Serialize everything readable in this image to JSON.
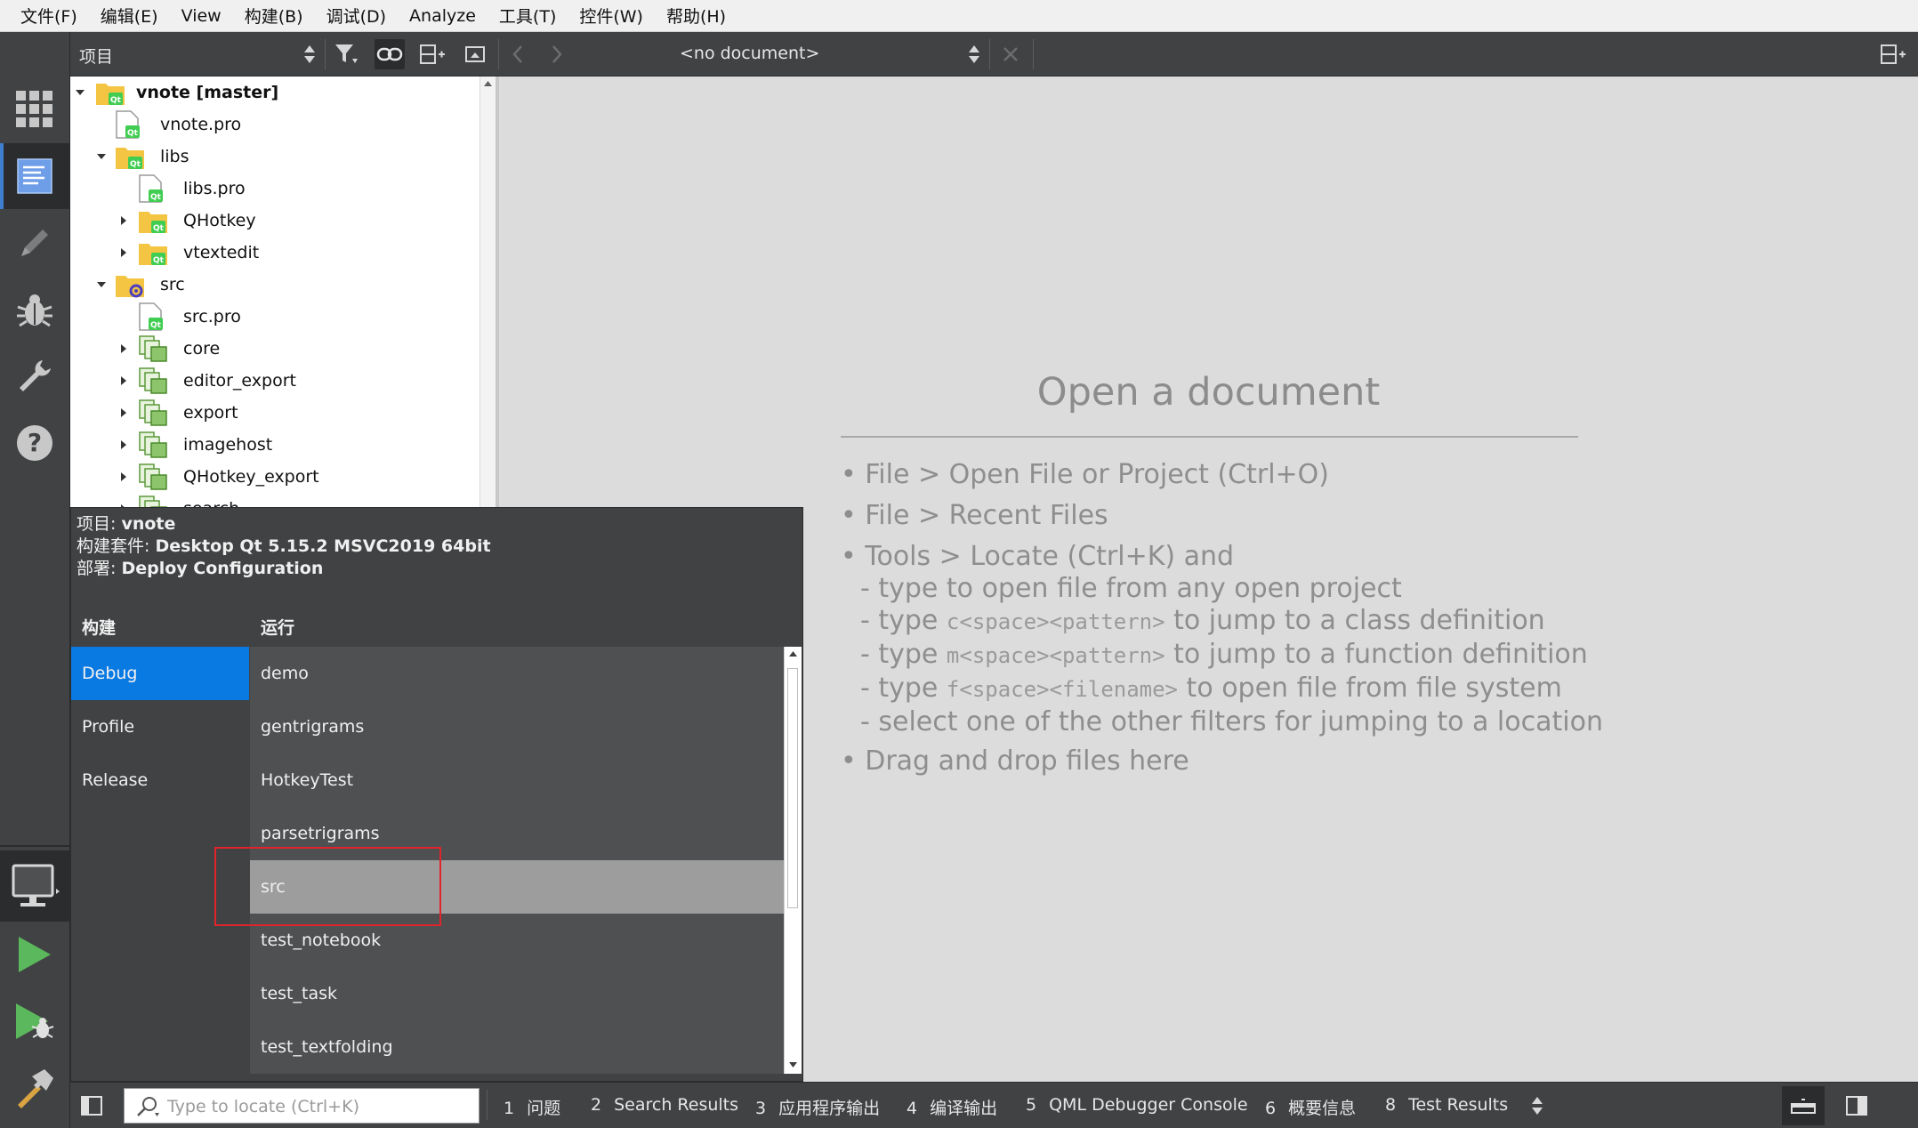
{
  "menu": [
    "文件(F)",
    "编辑(E)",
    "View",
    "构建(B)",
    "调试(D)",
    "Analyze",
    "工具(T)",
    "控件(W)",
    "帮助(H)"
  ],
  "toolbar": {
    "view_selector": "项目",
    "document_selector": "<no document>"
  },
  "tree": {
    "root": "vnote [master]",
    "items": [
      {
        "label": "vnote.pro"
      },
      {
        "label": "libs"
      },
      {
        "label": "libs.pro"
      },
      {
        "label": "QHotkey"
      },
      {
        "label": "vtextedit"
      },
      {
        "label": "src"
      },
      {
        "label": "src.pro"
      },
      {
        "label": "core"
      },
      {
        "label": "editor_export"
      },
      {
        "label": "export"
      },
      {
        "label": "imagehost"
      },
      {
        "label": "QHotkey_export"
      },
      {
        "label": "search"
      }
    ]
  },
  "editor": {
    "title": "Open a document",
    "tips": [
      "• File > Open File or Project (Ctrl+O)",
      "• File > Recent Files",
      "• Tools > Locate (Ctrl+K) and",
      "- type to open file from any open project"
    ],
    "tip5": {
      "a": "- type ",
      "code": "c<space><pattern>",
      "b": " to jump to a class definition"
    },
    "tip6": {
      "a": "- type ",
      "code": "m<space><pattern>",
      "b": " to jump to a function definition"
    },
    "tip7": {
      "a": "- type ",
      "code": "f<space><filename>",
      "b": " to open file from file system"
    },
    "tip8": "- select one of the other filters for jumping to a location",
    "tip9": "• Drag and drop files here"
  },
  "kit": {
    "project_label": "项目: ",
    "project_value": "vnote",
    "kit_label": "构建套件: ",
    "kit_value": "Desktop Qt 5.15.2 MSVC2019 64bit",
    "deploy_label": "部署: ",
    "deploy_value": "Deploy Configuration",
    "build_header": "构建",
    "run_header": "运行",
    "build_configs": [
      "Debug",
      "Profile",
      "Release"
    ],
    "build_selected": "Debug",
    "run_configs": [
      "demo",
      "gentrigrams",
      "HotkeyTest",
      "parsetrigrams",
      "src",
      "test_notebook",
      "test_task",
      "test_textfolding"
    ],
    "run_selected": "src"
  },
  "statusbar": {
    "locator_placeholder": "Type to locate (Ctrl+K)",
    "panes": [
      {
        "num": "1",
        "label": "问题"
      },
      {
        "num": "2",
        "label": "Search Results"
      },
      {
        "num": "3",
        "label": "应用程序输出"
      },
      {
        "num": "4",
        "label": "编译输出"
      },
      {
        "num": "5",
        "label": "QML Debugger Console"
      },
      {
        "num": "6",
        "label": "概要信息"
      },
      {
        "num": "8",
        "label": "Test Results"
      }
    ]
  },
  "colors": {
    "accent": "#0a7ae3",
    "highlight_box": "#e0242b",
    "dark_panel": "#404244",
    "qt_green": "#41cd52"
  },
  "icons": [
    "welcome-grid-icon",
    "edit-icon",
    "design-pencil-icon",
    "debug-bug-icon",
    "projects-wrench-icon",
    "help-icon",
    "kit-monitor-icon",
    "run-icon",
    "debug-run-icon",
    "build-hammer-icon"
  ]
}
